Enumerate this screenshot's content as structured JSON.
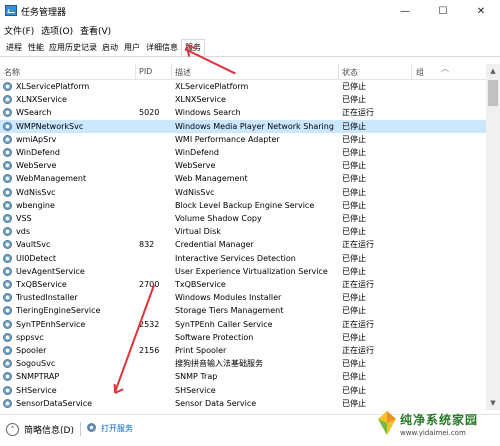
{
  "window": {
    "title": "任务管理器",
    "minimize": "—",
    "maximize": "☐",
    "close": "✕"
  },
  "menu": [
    "文件(F)",
    "选项(O)",
    "查看(V)"
  ],
  "tabs": [
    "进程",
    "性能",
    "应用历史记录",
    "启动",
    "用户",
    "详细信息",
    "服务"
  ],
  "active_tab": "服务",
  "columns": {
    "name": "名称",
    "pid": "PID",
    "description": "描述",
    "status": "状态",
    "group": "组"
  },
  "services": [
    {
      "name": "XLServicePlatform",
      "pid": "",
      "description": "XLServicePlatform",
      "status": "已停止"
    },
    {
      "name": "XLNXService",
      "pid": "",
      "description": "XLNXService",
      "status": "已停止"
    },
    {
      "name": "WSearch",
      "pid": "5020",
      "description": "Windows Search",
      "status": "正在运行"
    },
    {
      "name": "WMPNetworkSvc",
      "pid": "",
      "description": "Windows Media Player Network Sharing ...",
      "status": "已停止"
    },
    {
      "name": "wmiApSrv",
      "pid": "",
      "description": "WMI Performance Adapter",
      "status": "已停止"
    },
    {
      "name": "WinDefend",
      "pid": "",
      "description": "WinDefend",
      "status": "已停止"
    },
    {
      "name": "WebServe",
      "pid": "",
      "description": "WebServe",
      "status": "已停止"
    },
    {
      "name": "WebManagement",
      "pid": "",
      "description": "Web Management",
      "status": "已停止"
    },
    {
      "name": "WdNisSvc",
      "pid": "",
      "description": "WdNisSvc",
      "status": "已停止"
    },
    {
      "name": "wbengine",
      "pid": "",
      "description": "Block Level Backup Engine Service",
      "status": "已停止"
    },
    {
      "name": "VSS",
      "pid": "",
      "description": "Volume Shadow Copy",
      "status": "已停止"
    },
    {
      "name": "vds",
      "pid": "",
      "description": "Virtual Disk",
      "status": "已停止"
    },
    {
      "name": "VaultSvc",
      "pid": "832",
      "description": "Credential Manager",
      "status": "正在运行"
    },
    {
      "name": "UI0Detect",
      "pid": "",
      "description": "Interactive Services Detection",
      "status": "已停止"
    },
    {
      "name": "UevAgentService",
      "pid": "",
      "description": "User Experience Virtualization Service",
      "status": "已停止"
    },
    {
      "name": "TxQBService",
      "pid": "2700",
      "description": "TxQBService",
      "status": "正在运行"
    },
    {
      "name": "TrustedInstaller",
      "pid": "",
      "description": "Windows Modules Installer",
      "status": "已停止"
    },
    {
      "name": "TieringEngineService",
      "pid": "",
      "description": "Storage Tiers Management",
      "status": "已停止"
    },
    {
      "name": "SynTPEnhService",
      "pid": "2532",
      "description": "SynTPEnh Caller Service",
      "status": "正在运行"
    },
    {
      "name": "sppsvc",
      "pid": "",
      "description": "Software Protection",
      "status": "已停止"
    },
    {
      "name": "Spooler",
      "pid": "2156",
      "description": "Print Spooler",
      "status": "正在运行"
    },
    {
      "name": "SogouSvc",
      "pid": "",
      "description": "搜狗拼音输入法基础服务",
      "status": "已停止"
    },
    {
      "name": "SNMPTRAP",
      "pid": "",
      "description": "SNMP Trap",
      "status": "已停止"
    },
    {
      "name": "SHService",
      "pid": "",
      "description": "SHService",
      "status": "已停止"
    },
    {
      "name": "SensorDataService",
      "pid": "",
      "description": "Sensor Data Service",
      "status": "已停止"
    }
  ],
  "selected_service": "WMPNetworkSvc",
  "footer": {
    "collapse_label": "简略信息(D)",
    "open_services": "打开服务"
  },
  "watermark": {
    "name": "纯净系统家园",
    "url": "www.yidaimei.com"
  },
  "colors": {
    "selection": "#cce8ff",
    "arrow": "#e0343a",
    "link": "#0066cc"
  }
}
